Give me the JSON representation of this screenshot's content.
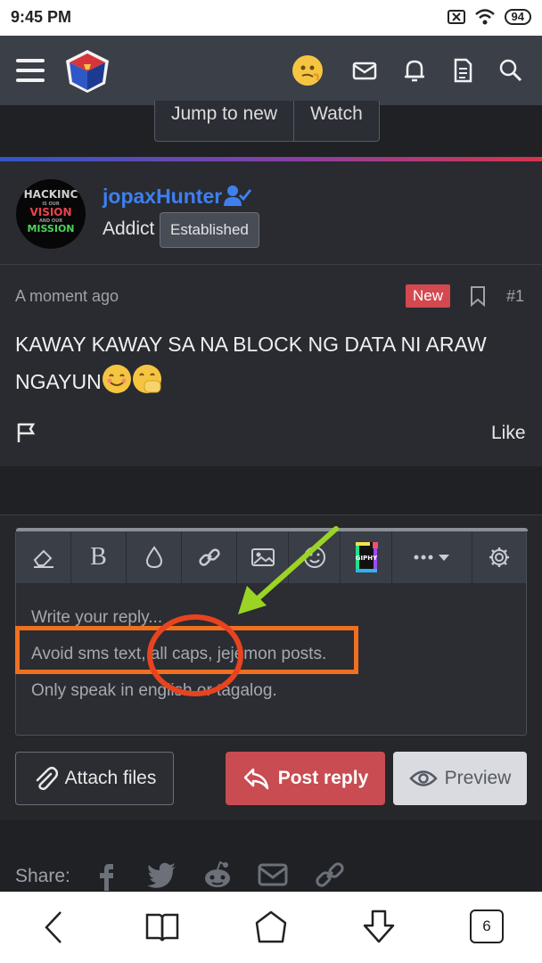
{
  "status_bar": {
    "time": "9:45 PM",
    "battery": "94"
  },
  "header": {
    "icons": [
      "menu-icon",
      "site-logo",
      "user-avatar",
      "inbox-icon",
      "alerts-bell-icon",
      "whats-new-icon",
      "search-icon"
    ]
  },
  "thread_nav": {
    "jump_label": "Jump to new",
    "watch_label": "Watch"
  },
  "post": {
    "avatar_lines": [
      "HACKINC",
      "IS OUR",
      "VISION",
      "AND OUR",
      "MISSION"
    ],
    "username": "jopaxHunter",
    "user_title": "Addict",
    "user_banner": "Established",
    "time": "A moment ago",
    "new_badge": "New",
    "number": "#1",
    "body": "KAWAY KAWAY SA NA BLOCK NG DATA NI ARAW NGAYUN",
    "like_label": "Like"
  },
  "editor": {
    "toolbar": [
      "eraser-icon",
      "bold-icon",
      "color-drop-icon",
      "link-icon",
      "image-icon",
      "smiley-icon",
      "giphy-icon",
      "more-options-icon",
      "settings-icon"
    ],
    "giphy_label": "GIPHY",
    "placeholder_lines": [
      "Write your reply...",
      "Avoid sms text, all caps, jejemon posts.",
      "Only speak in english or tagalog."
    ]
  },
  "actions": {
    "attach_label": "Attach files",
    "post_label": "Post reply",
    "preview_label": "Preview"
  },
  "share": {
    "label": "Share:",
    "icons": [
      "facebook-icon",
      "twitter-icon",
      "reddit-icon",
      "email-icon",
      "link-icon"
    ]
  },
  "bottom_nav": {
    "tab_count": "6"
  },
  "colors": {
    "accent": "#3e7ff0",
    "post_reply": "#c84c51",
    "annotation_rect": "#f0701f",
    "annotation_circle": "#e8431f",
    "annotation_arrow": "#9bd424"
  }
}
